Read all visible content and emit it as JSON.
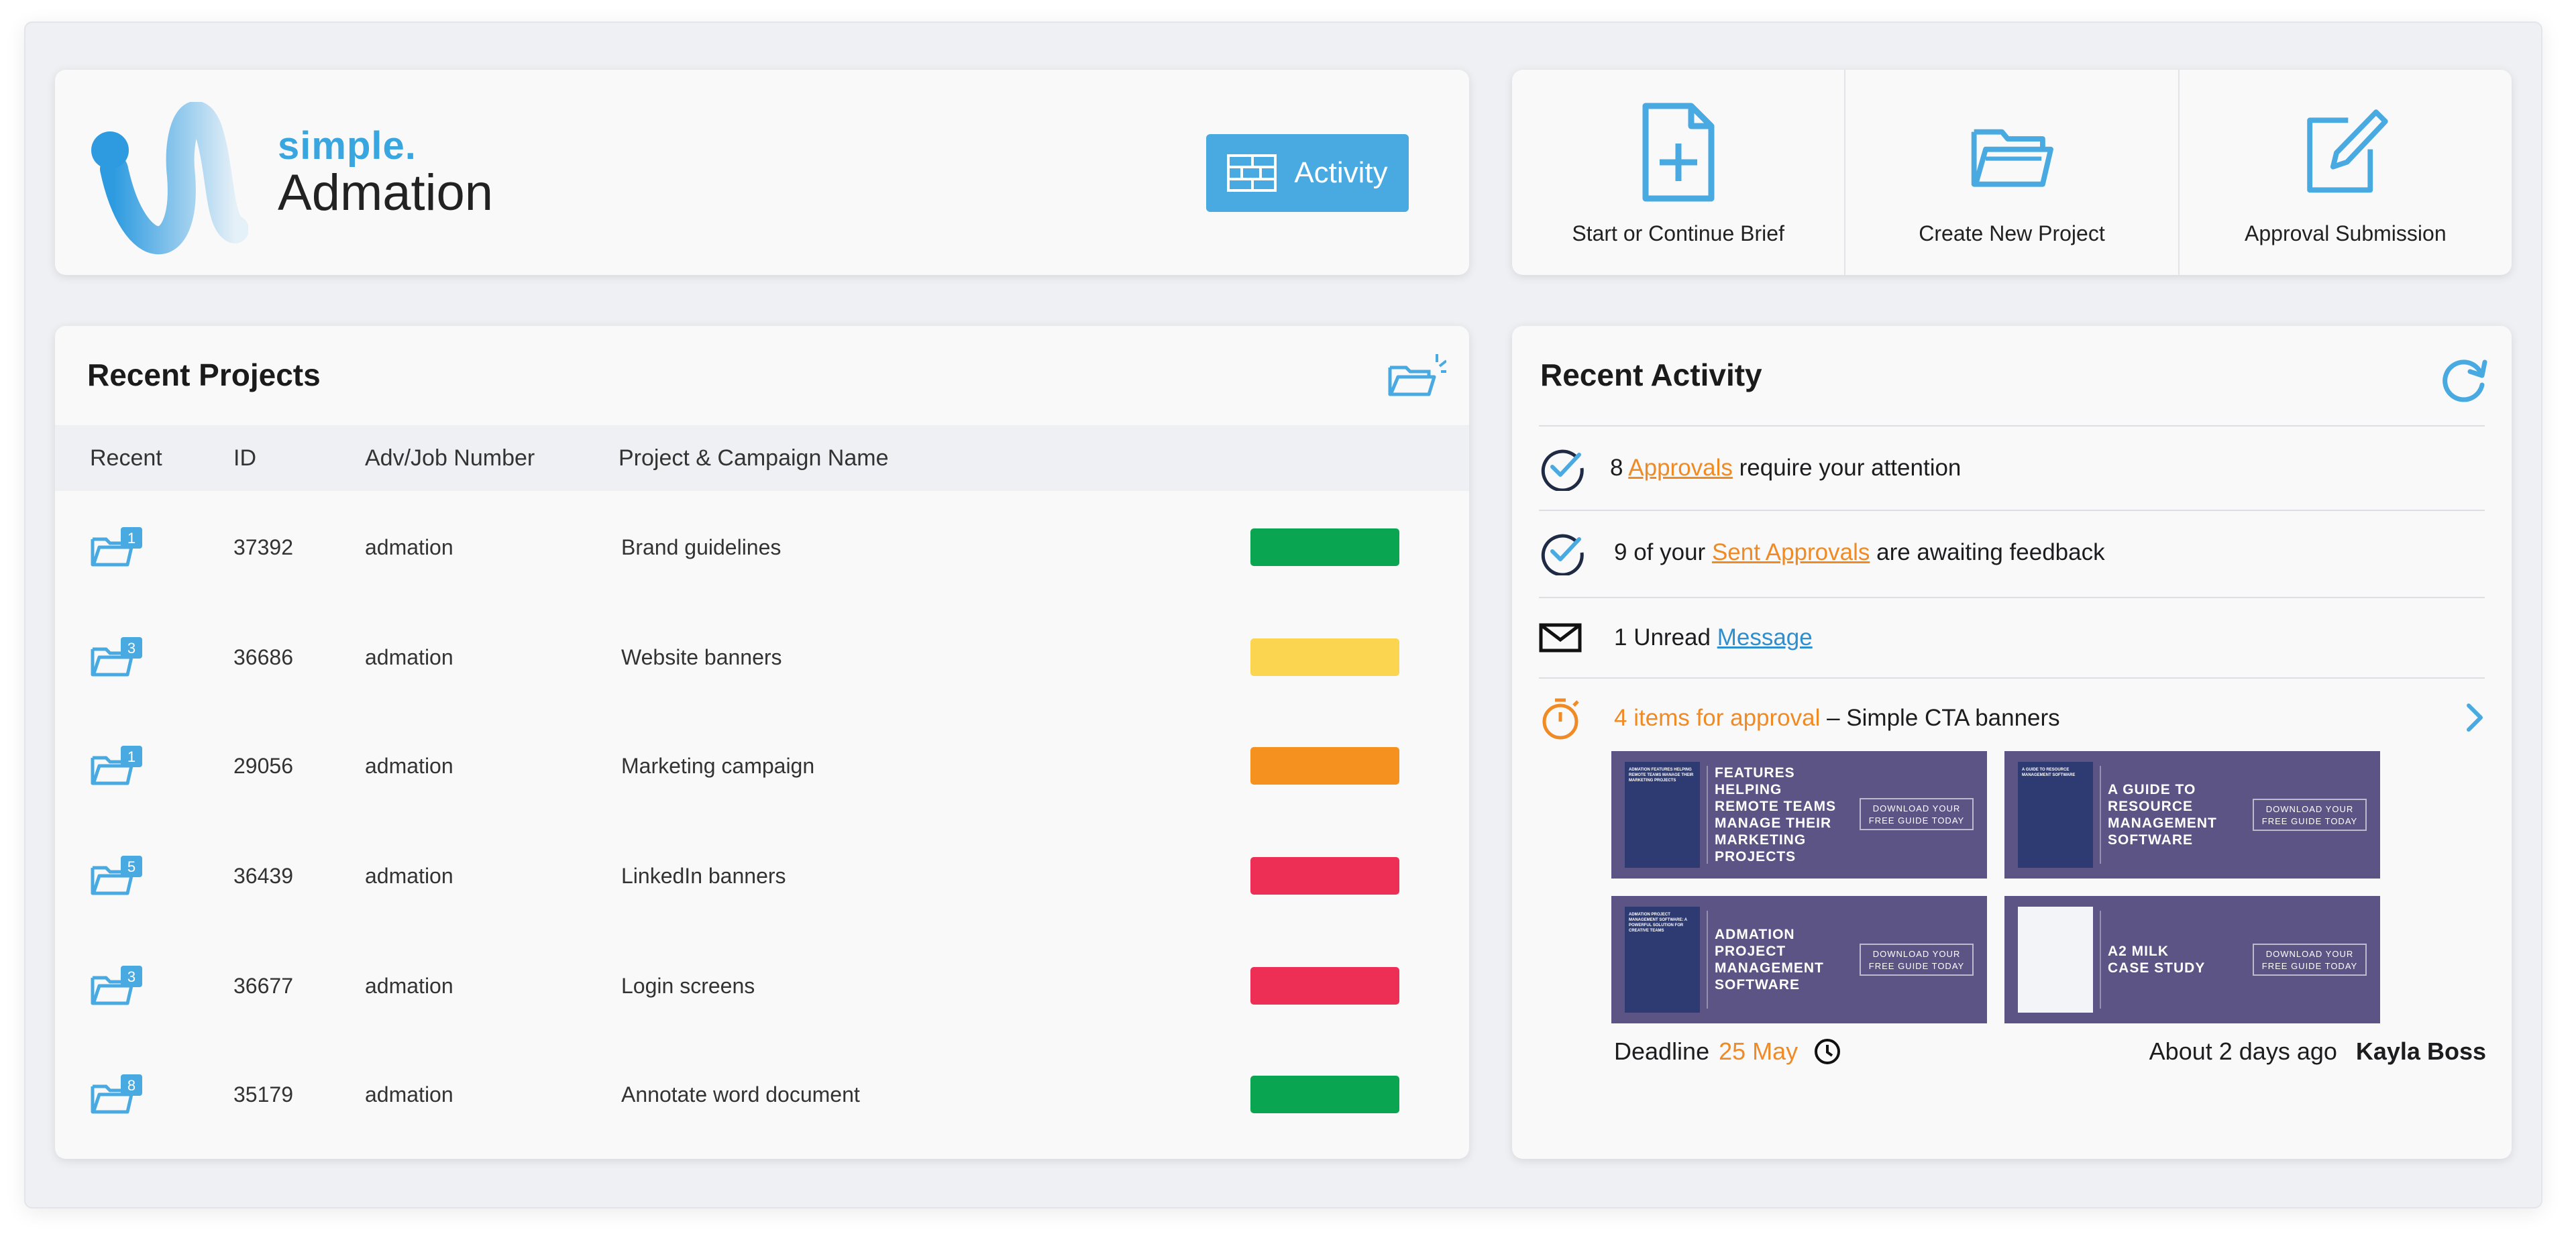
{
  "brand": {
    "small": "simple.",
    "name": "Admation"
  },
  "header": {
    "activity_button": "Activity"
  },
  "actions": [
    {
      "label": "Start or Continue Brief",
      "icon": "new-document-icon"
    },
    {
      "label": "Create New Project",
      "icon": "open-folder-icon"
    },
    {
      "label": "Approval Submission",
      "icon": "edit-pencil-icon"
    }
  ],
  "projects": {
    "title": "Recent Projects",
    "columns": [
      "Recent",
      "ID",
      "Adv/Job Number",
      "Project & Campaign Name"
    ],
    "rows": [
      {
        "count": "1",
        "id": "37392",
        "job": "admation",
        "name": "Brand guidelines",
        "status_color": "#0aa550"
      },
      {
        "count": "3",
        "id": "36686",
        "job": "admation",
        "name": "Website banners",
        "status_color": "#fbd54f"
      },
      {
        "count": "1",
        "id": "29056",
        "job": "admation",
        "name": "Marketing campaign",
        "status_color": "#f5921f"
      },
      {
        "count": "5",
        "id": "36439",
        "job": "admation",
        "name": "LinkedIn banners",
        "status_color": "#ed2f55"
      },
      {
        "count": "3",
        "id": "36677",
        "job": "admation",
        "name": "Login screens",
        "status_color": "#ed2f55"
      },
      {
        "count": "8",
        "id": "35179",
        "job": "admation",
        "name": "Annotate word document",
        "status_color": "#0aa550"
      }
    ]
  },
  "activity": {
    "title": "Recent Activity",
    "approvals": {
      "count": "8",
      "link": "Approvals",
      "suffix": "require your attention"
    },
    "sent": {
      "prefix": "9 of your",
      "link": "Sent Approvals",
      "suffix": "are awaiting feedback"
    },
    "messages": {
      "prefix": "1 Unread",
      "link": "Message"
    },
    "pending": {
      "highlight": "4 items for approval",
      "suffix": "– Simple CTA banners"
    },
    "thumbnails": [
      {
        "doc_text": "ADMATION FEATURES HELPING REMOTE TEAMS MANAGE THEIR MARKETING PROJECTS",
        "title": [
          "FEATURES",
          "HELPING",
          "REMOTE TEAMS",
          "MANAGE THEIR",
          "MARKETING",
          "PROJECTS"
        ],
        "cta": [
          "DOWNLOAD YOUR",
          "FREE GUIDE TODAY"
        ]
      },
      {
        "doc_text": "A GUIDE TO RESOURCE MANAGEMENT SOFTWARE",
        "title": [
          "A GUIDE TO",
          "RESOURCE",
          "MANAGEMENT",
          "SOFTWARE"
        ],
        "cta": [
          "DOWNLOAD YOUR",
          "FREE GUIDE TODAY"
        ]
      },
      {
        "doc_text": "ADMATION PROJECT MANAGEMENT SOFTWARE: A POWERFUL SOLUTION FOR CREATIVE TEAMS",
        "title": [
          "ADMATION",
          "PROJECT",
          "MANAGEMENT",
          "SOFTWARE"
        ],
        "cta": [
          "DOWNLOAD YOUR",
          "FREE GUIDE TODAY"
        ]
      },
      {
        "doc_text": "",
        "title": [
          "A2 MILK",
          "CASE STUDY"
        ],
        "cta": [
          "DOWNLOAD YOUR",
          "FREE GUIDE TODAY"
        ]
      }
    ],
    "deadline_label": "Deadline",
    "deadline_date": "25 May",
    "time_ago": "About 2 days ago",
    "user": "Kayla Boss"
  },
  "colors": {
    "accent": "#49a9e1",
    "orange": "#f08a24",
    "thumb_bg": "#5b5485"
  }
}
